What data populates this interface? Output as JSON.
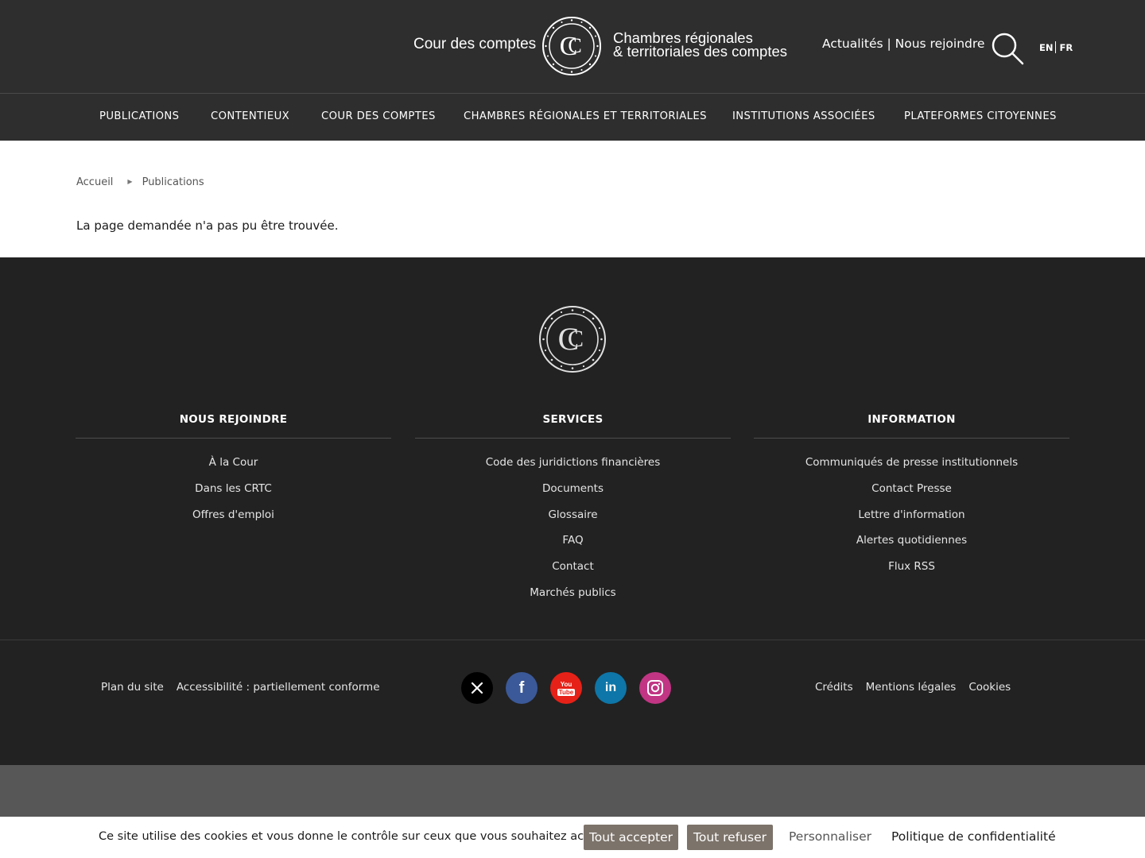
{
  "header": {
    "brand_left": "Cour des comptes",
    "brand_right_line1": "Chambres régionales",
    "brand_right_line2": "& territoriales des comptes",
    "links": {
      "news": "Actualités",
      "separator": " | ",
      "join": "Nous rejoindre"
    },
    "search_icon": "search-icon",
    "lang": {
      "en": "EN",
      "fr": "FR"
    }
  },
  "nav": {
    "items": [
      {
        "label": "PUBLICATIONS"
      },
      {
        "label": "CONTENTIEUX"
      },
      {
        "label": "COUR DES COMPTES"
      },
      {
        "label": "CHAMBRES RÉGIONALES ET TERRITORIALES"
      },
      {
        "label": "INSTITUTIONS ASSOCIÉES"
      },
      {
        "label": "PLATEFORMES CITOYENNES"
      }
    ]
  },
  "breadcrumb": {
    "home": "Accueil",
    "current": "Publications"
  },
  "main": {
    "message": "La page demandée n'a pas pu être trouvée."
  },
  "footer": {
    "columns": [
      {
        "title": "NOUS REJOINDRE",
        "links": [
          "À la Cour",
          "Dans les CRTC",
          "Offres d'emploi"
        ]
      },
      {
        "title": "SERVICES",
        "links": [
          "Code des juridictions financières",
          "Documents",
          "Glossaire",
          "FAQ",
          "Contact",
          "Marchés publics"
        ]
      },
      {
        "title": "INFORMATION",
        "links": [
          "Communiqués de presse institutionnels",
          "Contact Presse",
          "Lettre d'information",
          "Alertes quotidiennes",
          "Flux RSS"
        ]
      }
    ],
    "legal_left": {
      "sitemap": "Plan du site",
      "accessibility": "Accessibilité : partiellement conforme"
    },
    "legal_right": {
      "credits": "Crédits",
      "legal": "Mentions légales",
      "cookies": "Cookies"
    },
    "social": {
      "x": {
        "icon": "x-icon",
        "color": "#000000"
      },
      "facebook": {
        "icon": "facebook-icon",
        "color": "#3b5998"
      },
      "youtube": {
        "icon": "youtube-icon",
        "color": "#e62117",
        "label_top": "You",
        "label_bottom": "Tube"
      },
      "linkedin": {
        "icon": "linkedin-icon",
        "color": "#0e76a8",
        "label": "in"
      },
      "instagram": {
        "icon": "instagram-icon",
        "color": "#c13584"
      }
    }
  },
  "cookie_bar": {
    "text": "Ce site utilise des cookies et vous donne le contrôle sur ceux que vous souhaitez activer",
    "accept": "Tout accepter",
    "refuse": "Tout refuser",
    "customize": "Personnaliser",
    "privacy": "Politique de confidentialité"
  },
  "colors": {
    "header_bg": "#2e2e2e",
    "footer_bg": "#222222",
    "cookie_button": "#7c736a"
  }
}
